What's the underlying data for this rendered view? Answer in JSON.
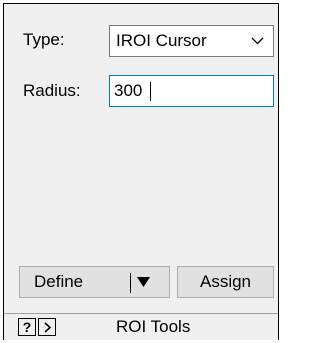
{
  "form": {
    "type_label": "Type:",
    "type_value": "IROI Cursor",
    "radius_label": "Radius:",
    "radius_value": "300"
  },
  "actions": {
    "define_label": "Define",
    "assign_label": "Assign"
  },
  "footer": {
    "help_label": "?",
    "title": "ROI Tools"
  },
  "icons": {
    "type_dropdown": "chevron-down-icon",
    "define_dropdown": "triangle-down-icon",
    "expand": "chevron-right-icon"
  },
  "colors": {
    "panel_bg": "#f0f0f0",
    "focus_border": "#0078d7",
    "button_bg": "#e1e1e1",
    "button_border": "#adadad"
  }
}
